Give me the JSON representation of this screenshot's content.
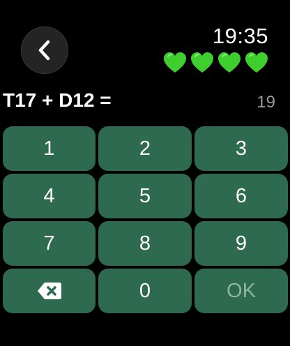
{
  "header": {
    "time": "19:35",
    "hearts": [
      "green-heart",
      "green-heart",
      "green-heart",
      "green-heart"
    ],
    "heart_color": "#3ecf2e"
  },
  "question": {
    "equation": "T17 + D12 =",
    "answer": "19"
  },
  "keypad": {
    "keys": [
      "1",
      "2",
      "3",
      "4",
      "5",
      "6",
      "7",
      "8",
      "9"
    ],
    "zero": "0",
    "ok": "OK",
    "delete_icon": "backspace-icon"
  },
  "colors": {
    "key_bg": "#2d6a4f",
    "ok_text_disabled": "#8fb59f",
    "answer_text": "#9a9a9a"
  }
}
